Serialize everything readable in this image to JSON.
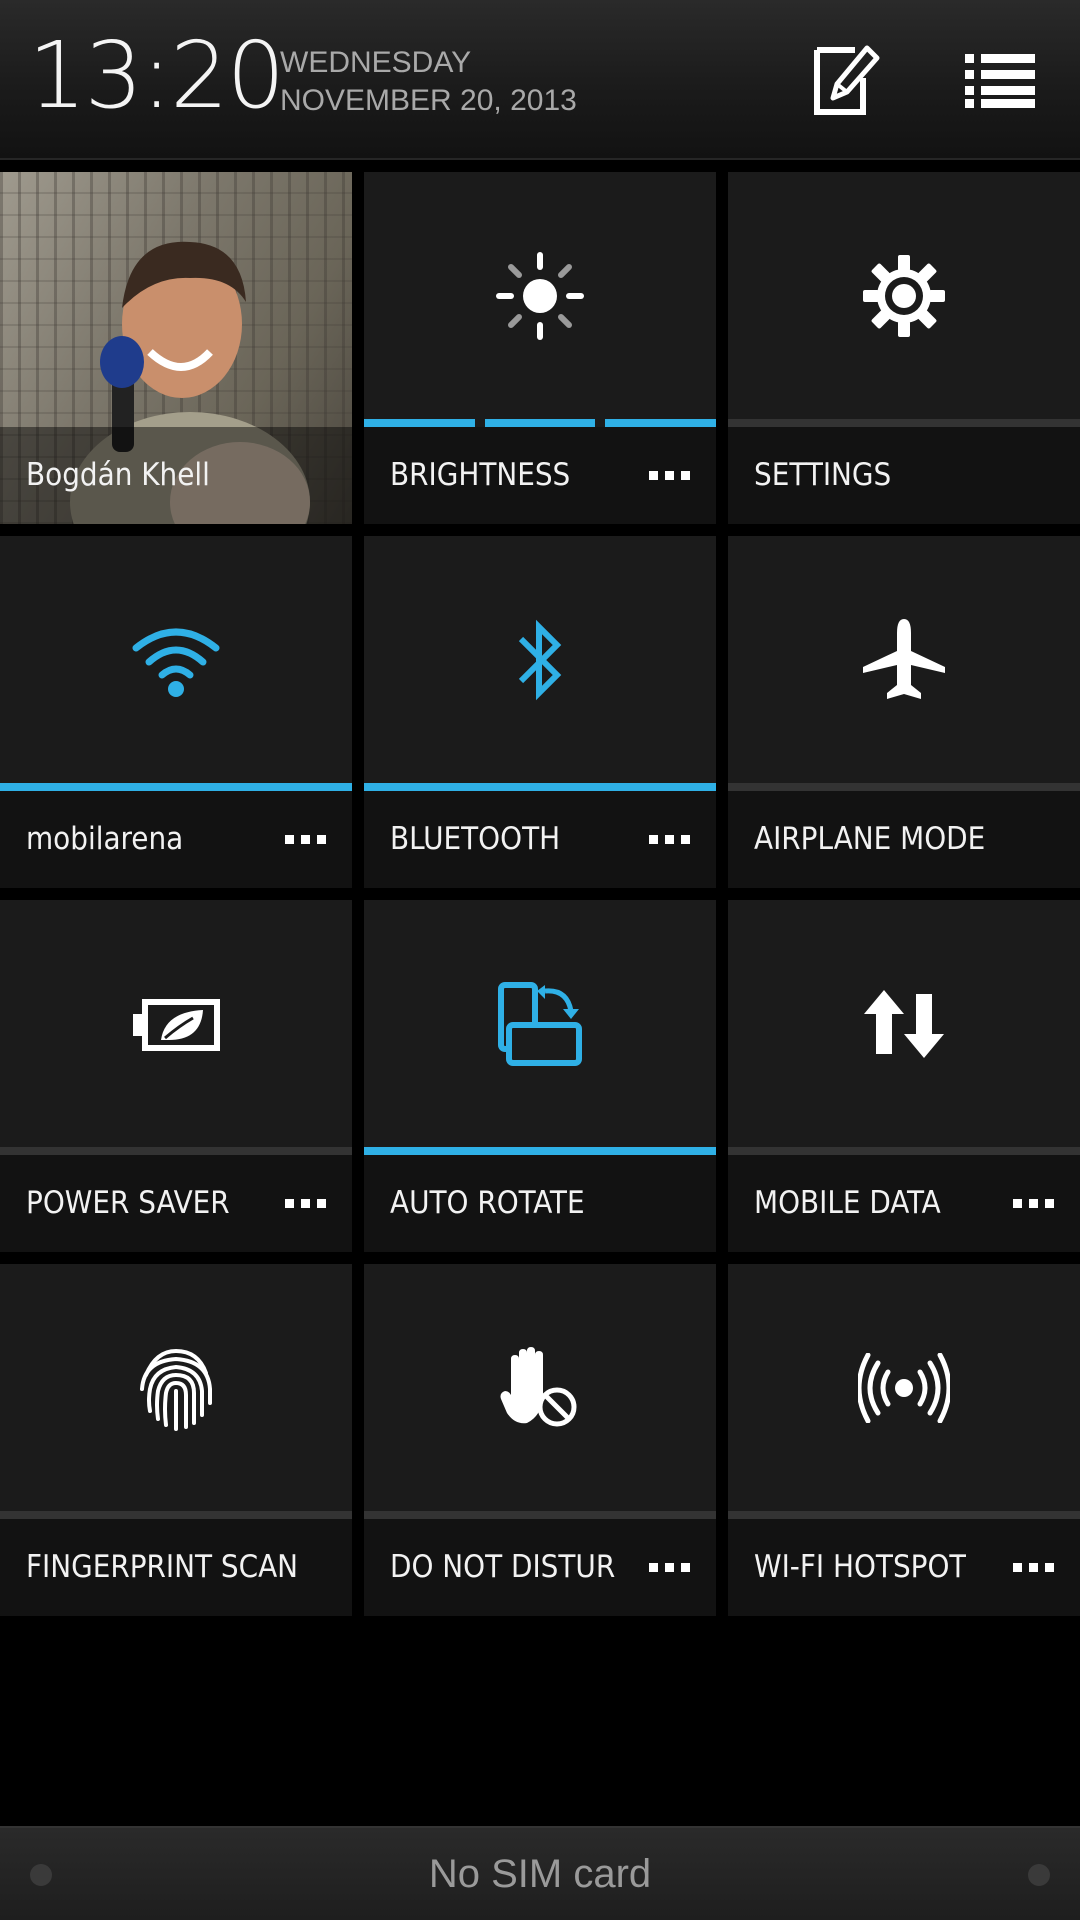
{
  "header": {
    "time": "13:20",
    "weekday": "WEDNESDAY",
    "date": "NOVEMBER 20, 2013",
    "note_icon": "note-edit-icon",
    "list_icon": "list-icon"
  },
  "accent_color": "#2fb0e6",
  "tiles": [
    {
      "label": "Bogdán Khell",
      "icon": "contact-photo"
    },
    {
      "label": "BRIGHTNESS",
      "icon": "brightness-icon",
      "state": "on",
      "has_more": true
    },
    {
      "label": "SETTINGS",
      "icon": "gear-icon",
      "state": "off",
      "has_more": false
    },
    {
      "label": "mobilarena",
      "icon": "wifi-icon",
      "state": "on",
      "has_more": true
    },
    {
      "label": "BLUETOOTH",
      "icon": "bluetooth-icon",
      "state": "on",
      "has_more": true
    },
    {
      "label": "AIRPLANE MODE",
      "icon": "airplane-icon",
      "state": "off",
      "has_more": false
    },
    {
      "label": "POWER SAVER",
      "icon": "battery-leaf-icon",
      "state": "off",
      "has_more": true
    },
    {
      "label": "AUTO ROTATE",
      "icon": "rotate-icon",
      "state": "on",
      "has_more": false
    },
    {
      "label": "MOBILE DATA",
      "icon": "mobile-data-icon",
      "state": "off",
      "has_more": true
    },
    {
      "label": "FINGERPRINT SCAN",
      "icon": "fingerprint-icon",
      "state": "off",
      "has_more": false
    },
    {
      "label": "DO NOT DISTURB",
      "icon": "do-not-disturb-icon",
      "state": "off",
      "has_more": true
    },
    {
      "label": "WI-FI HOTSPOT",
      "icon": "hotspot-icon",
      "state": "off",
      "has_more": true
    }
  ],
  "status_bar": {
    "sim_text": "No SIM card"
  }
}
